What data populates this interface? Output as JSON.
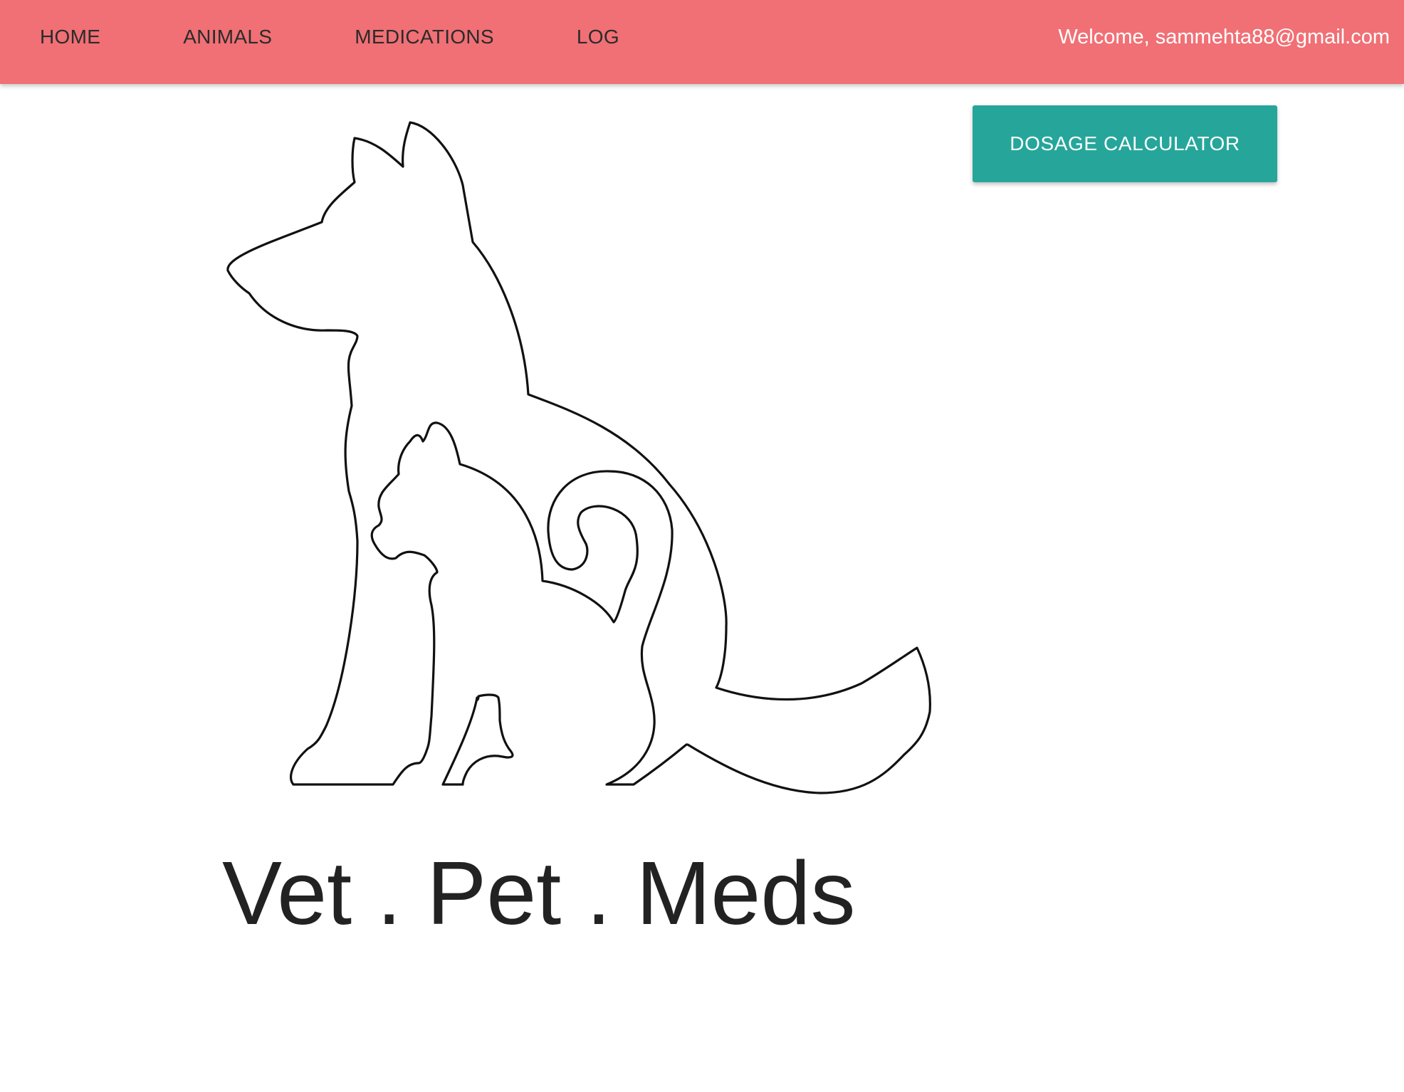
{
  "nav": {
    "items": [
      {
        "label": "HOME"
      },
      {
        "label": "ANIMALS"
      },
      {
        "label": "MEDICATIONS"
      },
      {
        "label": "LOG"
      }
    ],
    "welcome": "Welcome, sammehta88@gmail.com",
    "background_color": "#f07075"
  },
  "main": {
    "dosage_button_label": "DOSAGE CALCULATOR",
    "dosage_button_color": "#26a69a",
    "logo_icon": "dog-and-cat-outline-icon",
    "brand_title": "Vet . Pet . Meds"
  }
}
